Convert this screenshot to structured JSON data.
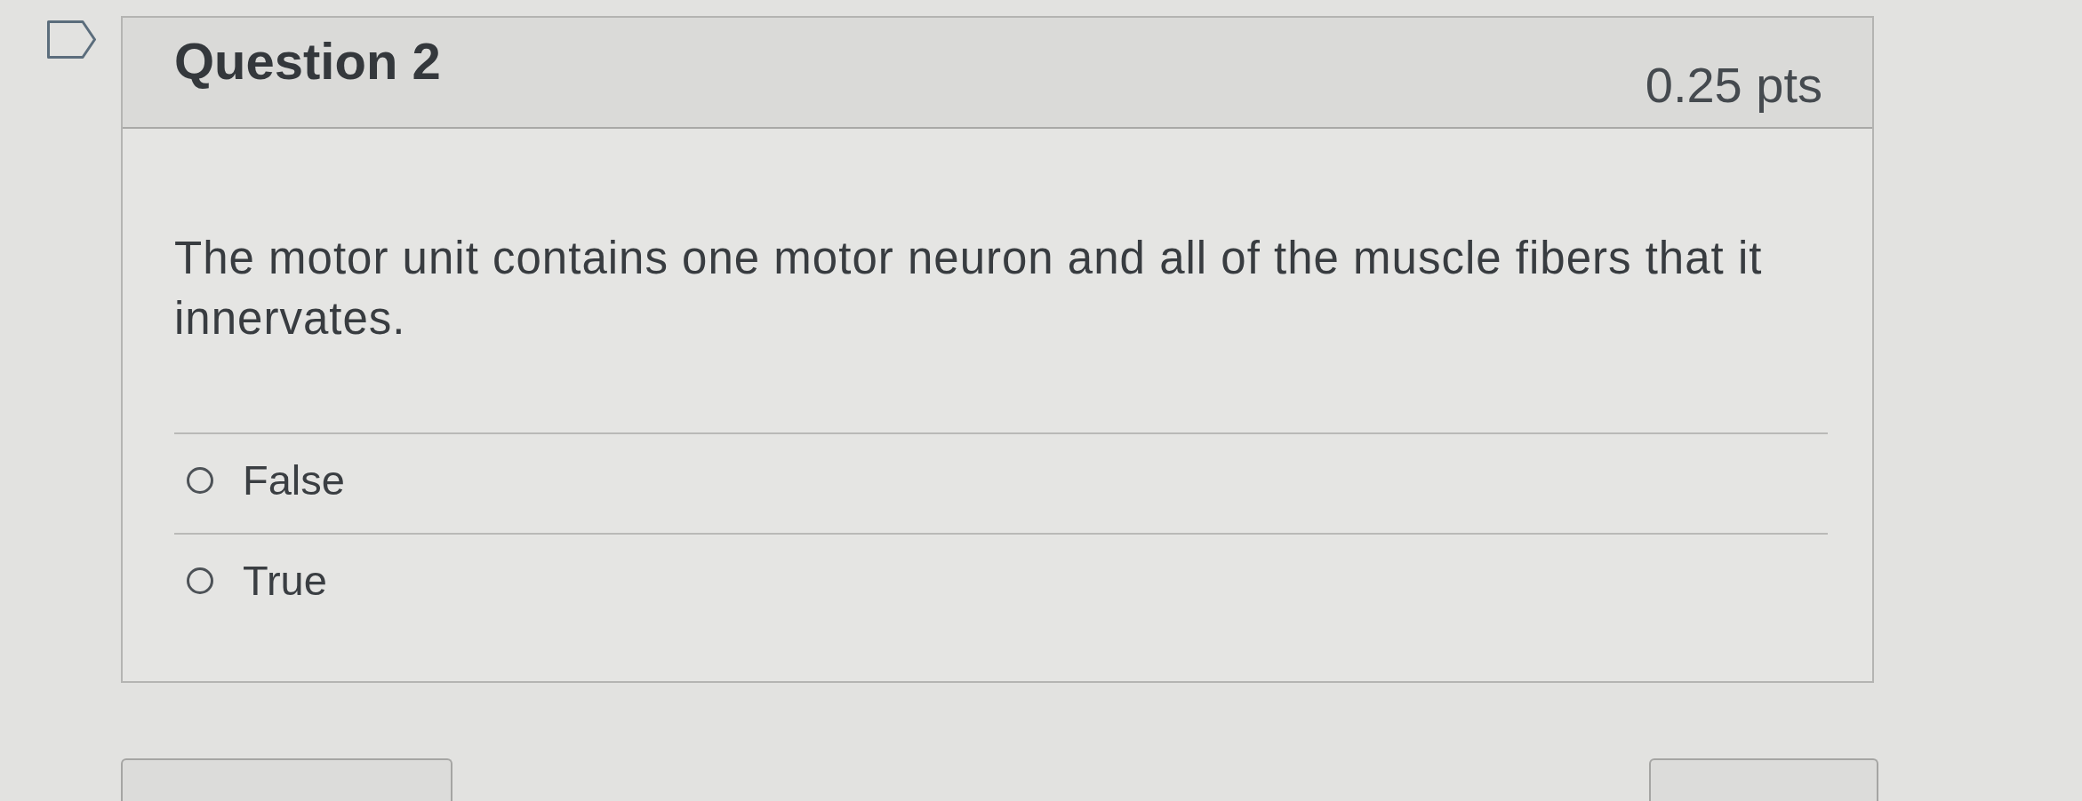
{
  "question": {
    "title": "Question 2",
    "points": "0.25 pts",
    "text": "The motor unit contains one motor neuron and all of the muscle fibers that it innervates.",
    "answers": [
      {
        "label": "False",
        "selected": false
      },
      {
        "label": "True",
        "selected": false
      }
    ]
  }
}
